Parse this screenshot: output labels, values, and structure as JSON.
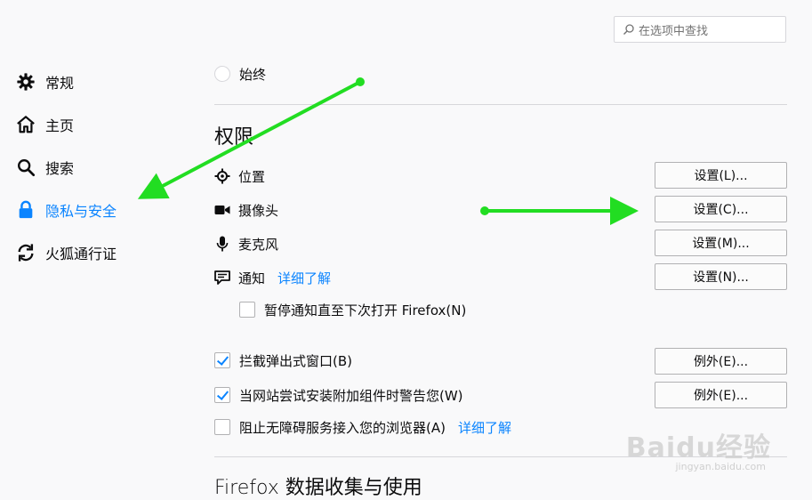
{
  "search": {
    "placeholder": "在选项中查找"
  },
  "sidebar": {
    "items": [
      {
        "label": "常规",
        "icon": "gear-icon"
      },
      {
        "label": "主页",
        "icon": "home-icon"
      },
      {
        "label": "搜索",
        "icon": "search-icon"
      },
      {
        "label": "隐私与安全",
        "icon": "lock-icon",
        "active": true
      },
      {
        "label": "火狐通行证",
        "icon": "sync-icon"
      }
    ]
  },
  "history": {
    "partial_option": "始终"
  },
  "permissions": {
    "title": "权限",
    "rows": [
      {
        "label": "位置",
        "icon": "location-icon",
        "button": "设置(L)..."
      },
      {
        "label": "摄像头",
        "icon": "camera-icon",
        "button": "设置(C)..."
      },
      {
        "label": "麦克风",
        "icon": "microphone-icon",
        "button": "设置(M)..."
      },
      {
        "label": "通知",
        "icon": "notification-icon",
        "link": "详细了解",
        "button": "设置(N)..."
      }
    ],
    "pause_notifications": {
      "label": "暂停通知直至下次打开 Firefox(N)",
      "checked": false
    },
    "block_popups": {
      "label": "拦截弹出式窗口(B)",
      "checked": true,
      "button": "例外(E)..."
    },
    "warn_addons": {
      "label": "当网站尝试安装附加组件时警告您(W)",
      "checked": true,
      "button": "例外(E)..."
    },
    "block_accessibility": {
      "label": "阻止无障碍服务接入您的浏览器(A)",
      "checked": false,
      "link": "详细了解"
    }
  },
  "data_collection": {
    "title": "Firefox 数据收集与使用"
  },
  "watermark": {
    "logo": "Baidu经验",
    "url": "jingyan.baidu.com"
  },
  "colors": {
    "accent": "#0a84ff",
    "annotation_arrow": "#22dd22"
  }
}
